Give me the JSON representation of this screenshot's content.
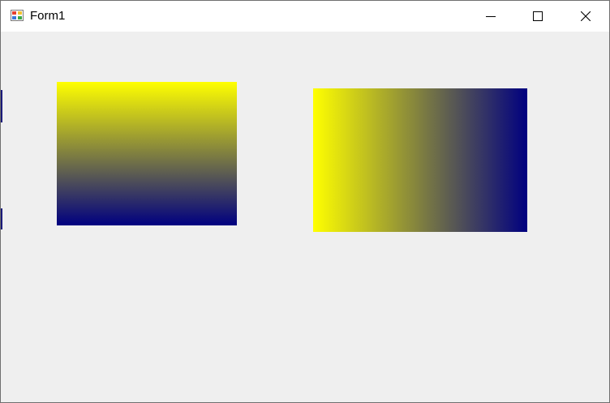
{
  "window": {
    "title": "Form1",
    "app_icon": "winforms-app-icon",
    "controls": {
      "minimize_icon": "minimize-icon",
      "maximize_icon": "maximize-icon",
      "close_icon": "close-icon"
    }
  },
  "gradients": {
    "vertical": {
      "direction": "top-to-bottom",
      "start_color": "#ffff00",
      "end_color": "#000080"
    },
    "horizontal": {
      "direction": "left-to-right",
      "start_color": "#ffff00",
      "end_color": "#000080"
    }
  },
  "colors": {
    "client_background": "#efefef",
    "titlebar_background": "#ffffff"
  }
}
